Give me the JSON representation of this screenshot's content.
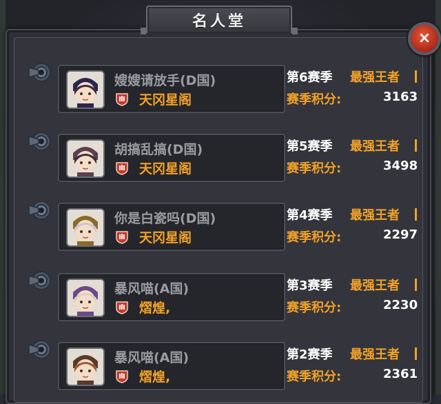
{
  "window": {
    "title": "名人堂"
  },
  "close": {
    "icon": "close-icon",
    "label": "×"
  },
  "entries": [
    {
      "player": "嫂嫂请放手(D国)",
      "guild": "天冈星阁",
      "season": "第6赛季",
      "rank": "最强王者",
      "score_label": "赛季积分:",
      "score": "3163",
      "avatar_hair": "#3a2e3a",
      "avatar_hat": "#2a2550"
    },
    {
      "player": "胡搞乱搞(D国)",
      "guild": "天冈星阁",
      "season": "第5赛季",
      "rank": "最强王者",
      "score_label": "赛季积分:",
      "score": "3498",
      "avatar_hair": "#3c2f3d",
      "avatar_hat": "#5a4050"
    },
    {
      "player": "你是白瓷吗(D国)",
      "guild": "天冈星阁",
      "season": "第4赛季",
      "rank": "最强王者",
      "score_label": "赛季积分:",
      "score": "2297",
      "avatar_hair": "#c9c6d6",
      "avatar_hat": "#8a6a2a"
    },
    {
      "player": "暴风喵(A国)",
      "guild": "熠煌,",
      "season": "第3赛季",
      "rank": "最强王者",
      "score_label": "赛季积分:",
      "score": "2230",
      "avatar_hair": "#d8d2c6",
      "avatar_hat": "#6a4a8a"
    },
    {
      "player": "暴风喵(A国)",
      "guild": "熠煌,",
      "season": "第2赛季",
      "rank": "最强王者",
      "score_label": "赛季积分:",
      "score": "2361",
      "avatar_hair": "#9a5a32",
      "avatar_hat": "#5a3a2a"
    }
  ],
  "colors": {
    "accent": "#f2a227",
    "name_gray": "#9b9ca2",
    "panel": "#2f3037",
    "close_red": "#c0392b"
  }
}
